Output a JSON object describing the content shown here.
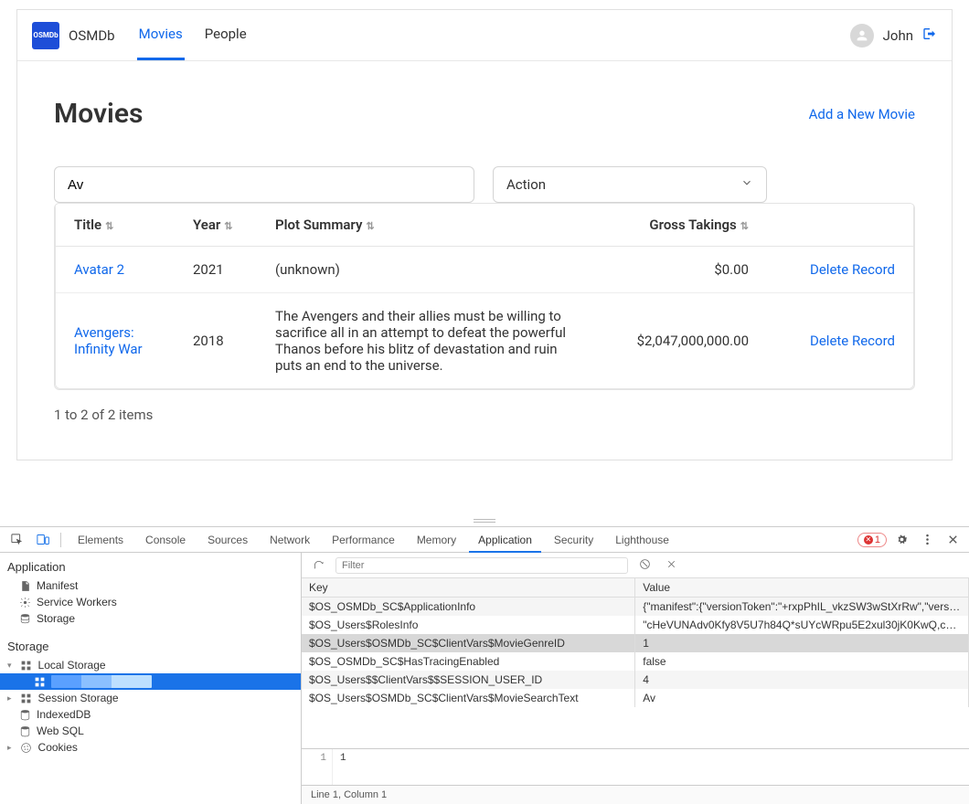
{
  "header": {
    "brand": "OSMDb",
    "logo_text": "OSMDb",
    "nav": [
      "Movies",
      "People"
    ],
    "active_nav": 0,
    "username": "John"
  },
  "page": {
    "title": "Movies",
    "add_link": "Add a New Movie"
  },
  "filters": {
    "search_value": "Av",
    "search_placeholder": "",
    "genre_selected": "Action"
  },
  "table": {
    "columns": [
      "Title",
      "Year",
      "Plot Summary",
      "Gross Takings"
    ],
    "rows": [
      {
        "title": "Avatar 2",
        "year": "2021",
        "plot": "(unknown)",
        "gross": "$0.00",
        "action": "Delete Record"
      },
      {
        "title": "Avengers: Infinity War",
        "year": "2018",
        "plot": "The Avengers and their allies must be willing to sacrifice all in an attempt to defeat the powerful Thanos before his blitz of devastation and ruin puts an end to the universe.",
        "gross": "$2,047,000,000.00",
        "action": "Delete Record"
      }
    ],
    "pagination": "1 to 2 of 2 items"
  },
  "devtools": {
    "tabs": [
      "Elements",
      "Console",
      "Sources",
      "Network",
      "Performance",
      "Memory",
      "Application",
      "Security",
      "Lighthouse"
    ],
    "active_tab": 6,
    "error_count": "1",
    "sidebar": {
      "application_title": "Application",
      "application_items": [
        "Manifest",
        "Service Workers",
        "Storage"
      ],
      "storage_title": "Storage",
      "local_storage": "Local Storage",
      "session_storage": "Session Storage",
      "indexeddb": "IndexedDB",
      "websql": "Web SQL",
      "cookies": "Cookies"
    },
    "toolbar": {
      "filter_placeholder": "Filter"
    },
    "storage_table": {
      "headers": [
        "Key",
        "Value"
      ],
      "rows": [
        {
          "key": "$OS_OSMDb_SC$ApplicationInfo",
          "value": "{\"manifest\":{\"versionToken\":\"+rxpPhIL_vkzSW3wStXrRw\",\"versi…"
        },
        {
          "key": "$OS_Users$RolesInfo",
          "value": "\"cHeVUNAdv0Kfy8V5U7h84Q*sUYcWRpu5E2xul30jK0KwQ,cH…"
        },
        {
          "key": "$OS_Users$OSMDb_SC$ClientVars$MovieGenreID",
          "value": "1",
          "highlight": true
        },
        {
          "key": "$OS_OSMDb_SC$HasTracingEnabled",
          "value": "false"
        },
        {
          "key": "$OS_Users$$ClientVars$$SESSION_USER_ID",
          "value": "4"
        },
        {
          "key": "$OS_Users$OSMDb_SC$ClientVars$MovieSearchText",
          "value": "Av"
        }
      ]
    },
    "editor": {
      "line_number": "1",
      "content": "1"
    },
    "status_bar": "Line 1, Column 1"
  }
}
